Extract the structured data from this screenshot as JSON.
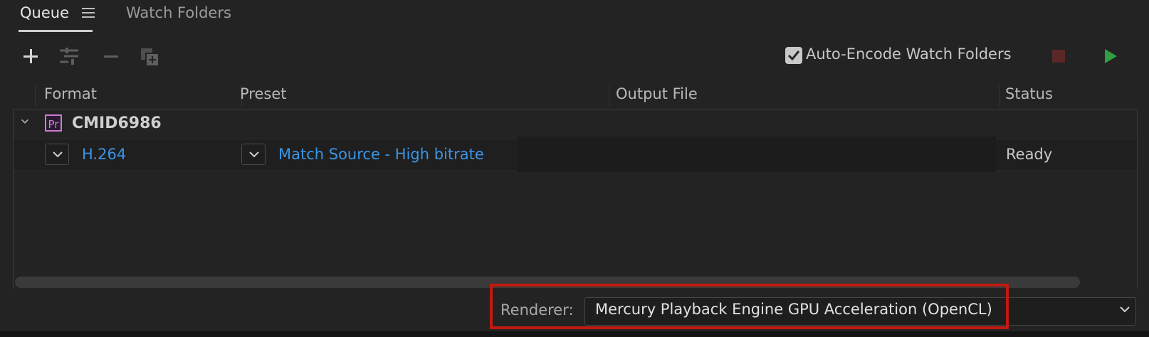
{
  "tabs": {
    "queue_label": "Queue",
    "watch_folders_label": "Watch Folders"
  },
  "toolbar": {
    "auto_encode_label": "Auto-Encode Watch Folders",
    "auto_encode_checked": true,
    "icons": [
      "plus-icon",
      "settings-icon",
      "minus-icon",
      "duplicate-icon",
      "stop-icon",
      "play-icon"
    ],
    "colors": {
      "stop": "#5b2727",
      "play": "#2ea043"
    }
  },
  "columns": {
    "format": "Format",
    "preset": "Preset",
    "output_file": "Output File",
    "status": "Status"
  },
  "queue": {
    "group": {
      "name": "CMID6986",
      "icon": "premiere-pro-icon",
      "icon_text": "Pr"
    },
    "job": {
      "format": "H.264",
      "preset": "Match Source - High bitrate",
      "output_file": "",
      "status": "Ready"
    }
  },
  "renderer": {
    "label": "Renderer:",
    "value": "Mercury Playback Engine GPU Acceleration (OpenCL)",
    "highlight_color": "#c21a10"
  }
}
